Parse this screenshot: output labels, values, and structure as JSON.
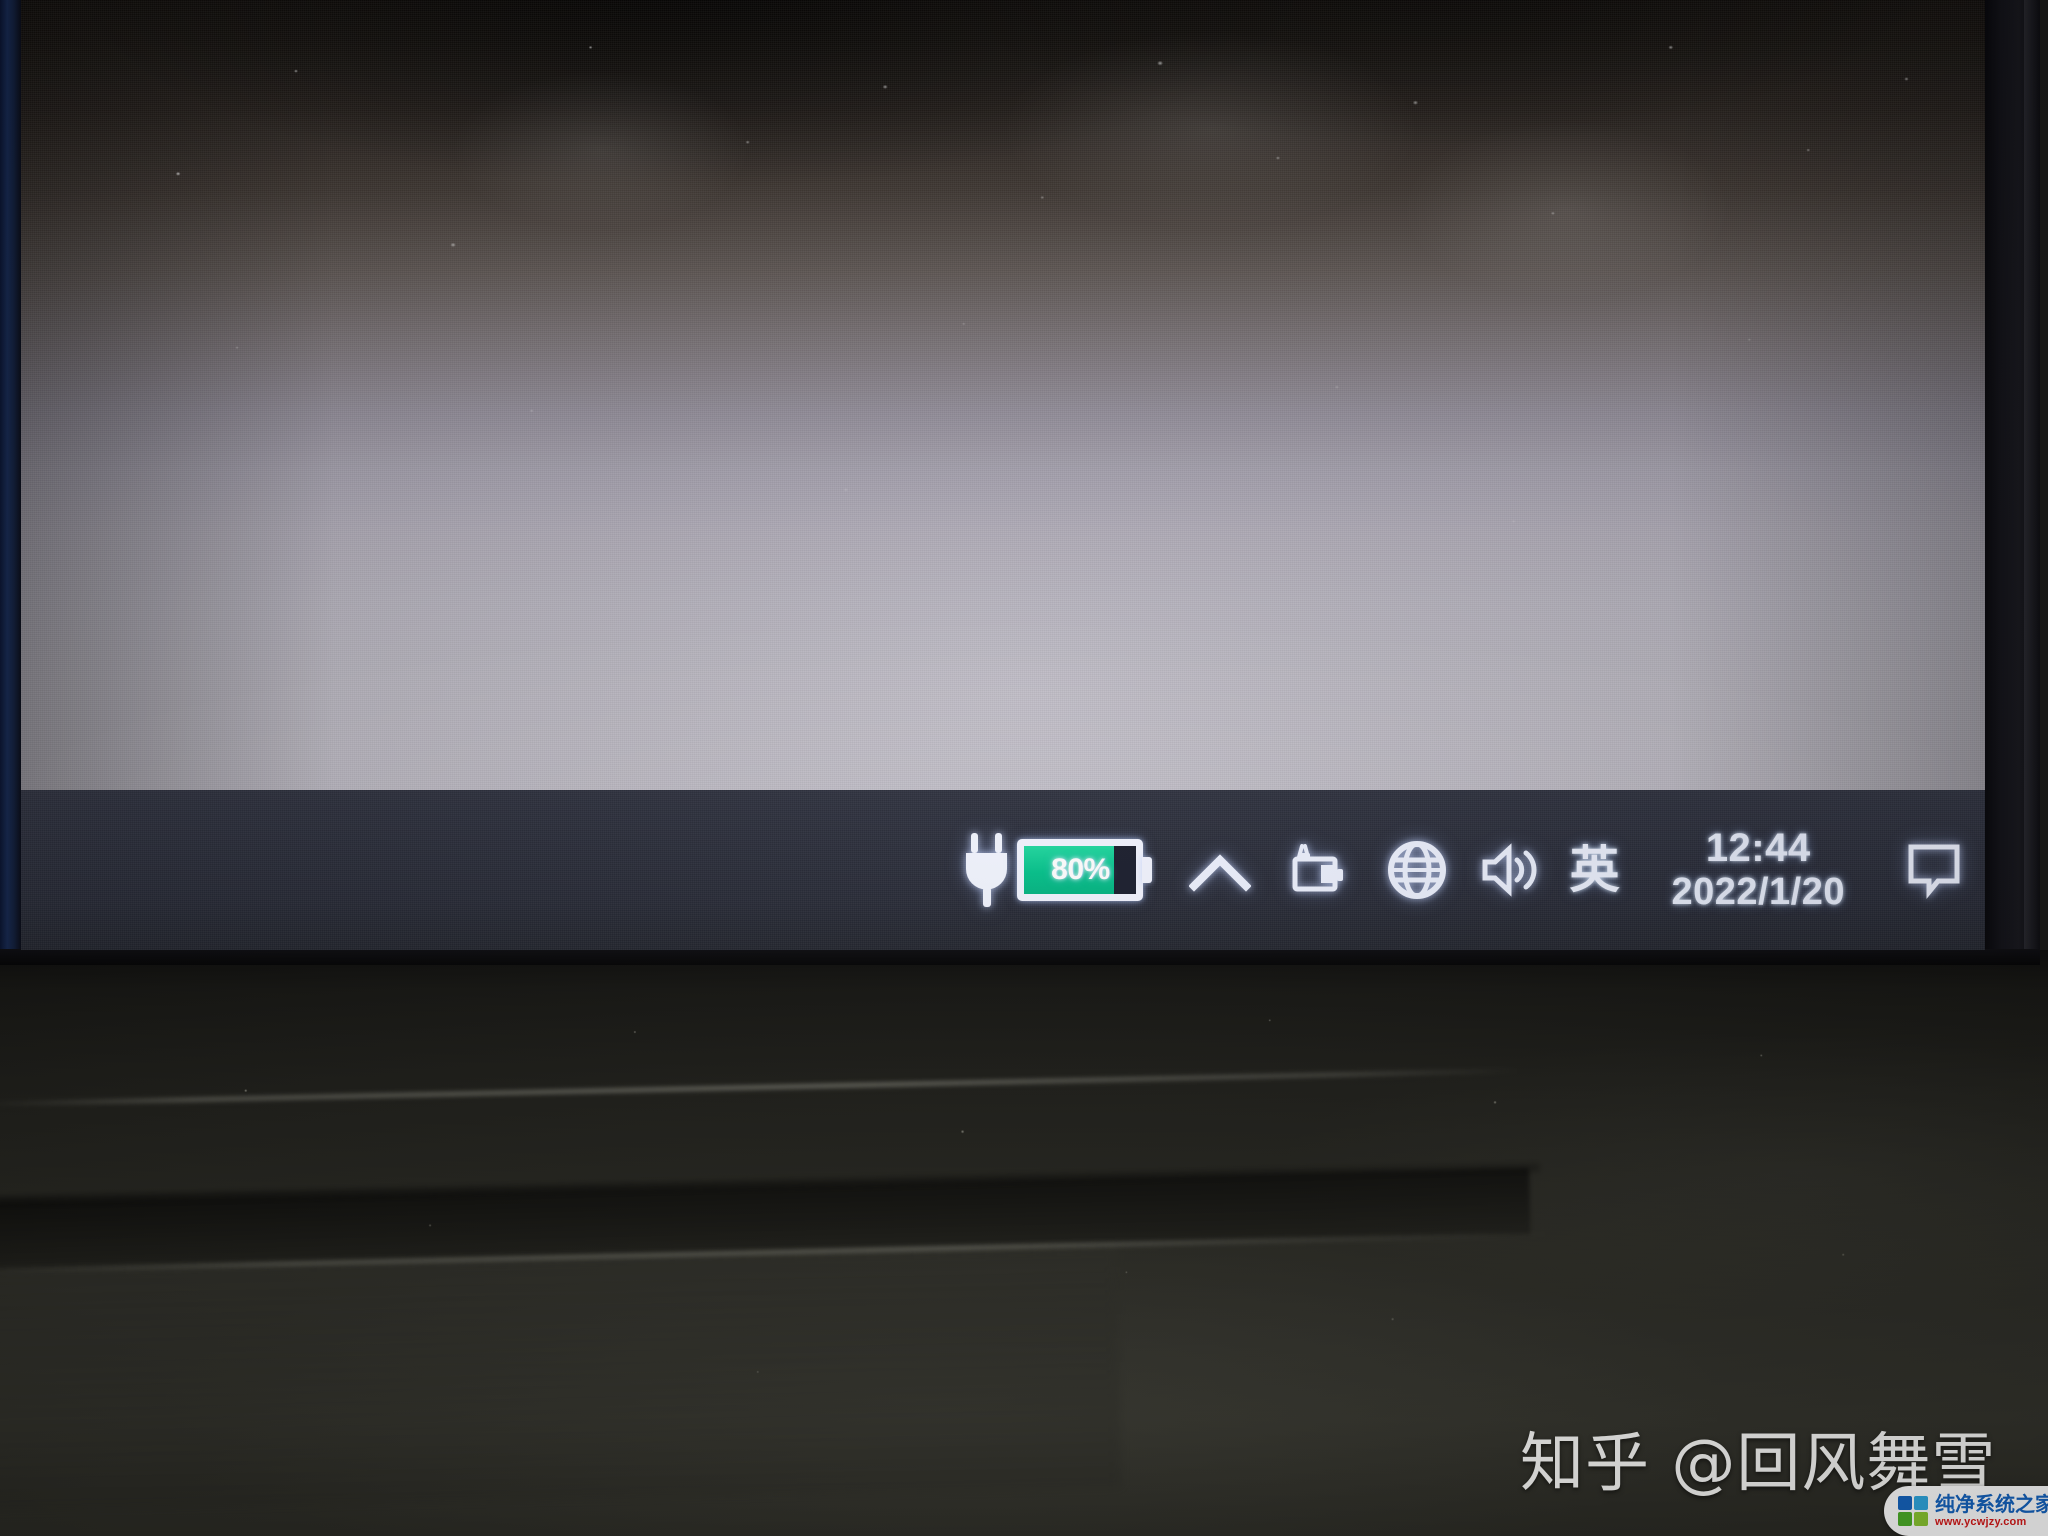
{
  "scene": {
    "description": "Photograph of a laptop screen bottom corner showing the Windows 10 taskbar system tray",
    "device": "laptop"
  },
  "desktop": {
    "wallpaper_note": "plain light grey-lavender desktop, dusty screen, dark vignette at top"
  },
  "taskbar": {
    "background_color": "#2b2e3b",
    "tray": {
      "power_plug": {
        "name": "power-plug-icon",
        "tooltip": "Plugged in, charging"
      },
      "battery": {
        "name": "battery-percentage",
        "percent_label": "80%",
        "percent_value": 80,
        "fill_color": "#06c28c",
        "outline_color": "#f2f4ff",
        "charging": true
      },
      "show_hidden": {
        "name": "show-hidden-icons-chevron",
        "label": "^"
      },
      "battery_tray": {
        "name": "battery-tray-icon",
        "label": "Battery"
      },
      "network": {
        "name": "network-globe-icon",
        "label": "Network"
      },
      "volume": {
        "name": "volume-speaker-icon",
        "label": "Volume"
      },
      "ime": {
        "name": "ime-indicator",
        "label": "英"
      },
      "clock": {
        "time": "12:44",
        "date": "2022/1/20"
      },
      "action_center": {
        "name": "action-center-icon",
        "label": "Notifications"
      }
    }
  },
  "watermarks": {
    "zhihu": "知乎 @回风舞雪",
    "site": {
      "name_cn": "纯净系统之家",
      "url": "www.ycwjzy.com",
      "logo_colors": [
        "#1565c0",
        "#2fa8e0",
        "#4caf28",
        "#8bc832"
      ],
      "text_color": "#1564c0",
      "url_color": "#d81919"
    }
  }
}
